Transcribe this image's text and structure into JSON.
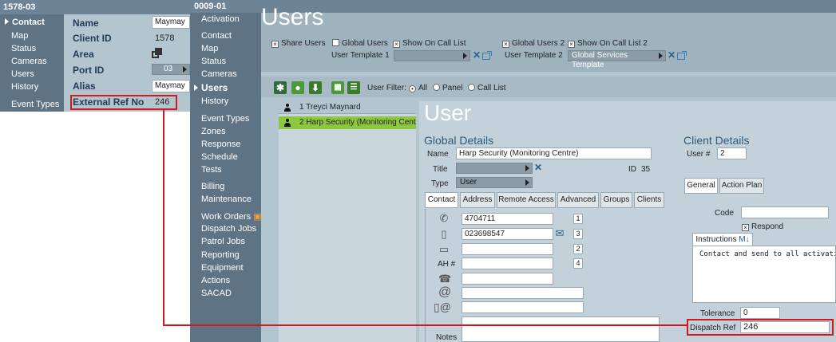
{
  "left_window": {
    "title": "1578-03",
    "nav": [
      "Contact",
      "Map",
      "Status",
      "Cameras",
      "Users",
      "History",
      "Event Types"
    ],
    "fields": {
      "name_label": "Name",
      "name_value": "Maymay",
      "client_id_label": "Client ID",
      "client_id_value": "1578",
      "area_label": "Area",
      "port_id_label": "Port ID",
      "port_id_value": "03",
      "alias_label": "Alias",
      "alias_value": "Maymay",
      "external_ref_label": "External Ref No",
      "external_ref_value": "246"
    }
  },
  "main_window": {
    "title": "0009-01",
    "page_title": "Users",
    "nav": [
      "Activation",
      "Contact",
      "Map",
      "Status",
      "Cameras",
      "Users",
      "History",
      "Event Types",
      "Zones",
      "Response",
      "Schedule",
      "Tests",
      "Billing",
      "Maintenance",
      "Work Orders",
      "Dispatch Jobs",
      "Patrol Jobs",
      "Reporting",
      "Equipment",
      "Actions",
      "SACAD"
    ],
    "options": {
      "share_users": "Share Users",
      "global_users": "Global Users",
      "show_on_call_list": "Show On Call List",
      "user_template_1": "User Template 1",
      "global_users_2": "Global Users 2",
      "show_on_call_list_2": "Show On Call List 2",
      "user_template_2": "User Template 2",
      "user_template_2_value": "Global Services Template"
    },
    "filter": {
      "label": "User Filter:",
      "all": "All",
      "panel": "Panel",
      "call_list": "Call List"
    },
    "users": [
      {
        "label": "1 Treyci Maynard"
      },
      {
        "label": "2 Harp Security (Monitoring Centre)"
      }
    ],
    "user_heading": "User",
    "global_details": {
      "title": "Global Details",
      "name_label": "Name",
      "name_value": "Harp Security (Monitoring Centre)",
      "title_label": "Title",
      "id_label": "ID",
      "id_value": "35",
      "type_label": "Type",
      "type_value": "User",
      "tabs": [
        "Contact",
        "Address",
        "Remote Access",
        "Advanced",
        "Groups",
        "Clients"
      ],
      "phone_1": "4704711",
      "phone_1_order": "1",
      "mobile": "023698547",
      "mobile_order": "3",
      "fax_order": "2",
      "ah_label": "AH #",
      "ah_order": "4",
      "notes_label": "Notes"
    },
    "client_details": {
      "title": "Client Details",
      "user_num_label": "User #",
      "user_num_value": "2",
      "tabs": [
        "General",
        "Action Plan"
      ],
      "code_label": "Code",
      "respond_label": "Respond",
      "instructions_tab": "Instructions",
      "instructions_text": "Contact and send to all activation",
      "tolerance_label": "Tolerance",
      "tolerance_value": "0",
      "dispatch_ref_label": "Dispatch Ref",
      "dispatch_ref_value": "246"
    }
  },
  "colors": {
    "highlight": "#d0191f",
    "selected_row": "#8dc63f",
    "sidebar": "#5e7485",
    "panel": "#b3c5cf"
  }
}
